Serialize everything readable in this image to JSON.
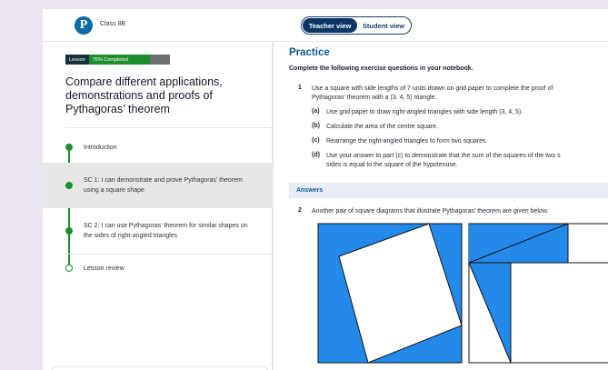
{
  "header": {
    "logo_letter": "P",
    "class_label": "Class 8B",
    "teacher_view": "Teacher view",
    "student_view": "Student view"
  },
  "sidebar": {
    "badge_lesson": "Lesson",
    "badge_progress": "75% Completed",
    "progress_fraction": 0.75,
    "title": "Compare different applications, demonstrations and proofs of Pythagoras’ theorem",
    "steps": [
      {
        "label": "Introduction"
      },
      {
        "label": "SC 1: I can demonstrate and prove Pythagoras’ theorem using a square shape"
      },
      {
        "label": "SC 2: I can use Pythagoras’ theorem for similar shapes on the sides of right-angled triangles"
      },
      {
        "label": "Lesson review"
      }
    ]
  },
  "main": {
    "heading": "Practice",
    "intro": "Complete the following exercise questions in your notebook.",
    "q1": {
      "number": "1",
      "line1": "Use a square with side lengths of 7 units drawn on grid paper to complete the proof of",
      "line2": "Pythagoras’ theorem with a (3, 4, 5) triangle.",
      "parts": [
        {
          "letter": "(a)",
          "text": "Use grid paper to draw right-angled triangles with side length (3, 4, 5)."
        },
        {
          "letter": "(b)",
          "text": "Calculate the area of the centre square."
        },
        {
          "letter": "(c)",
          "text": "Rearrange the right-angled triangles to form two squares."
        },
        {
          "letter": "(d)",
          "text": "Use your answer to part (c) to demonstrate that the sum of the squares of the two s",
          "text2": "sides is equal to the square of the hypotenuse."
        }
      ]
    },
    "answers_label": "Answers",
    "q2": {
      "number": "2",
      "text": "Another pair of square diagrams that illustrate Pythagoras’ theorem are given below."
    }
  },
  "colors": {
    "brand_blue": "#0a5a95",
    "toggle_active": "#0a3764",
    "progress_green": "#1e8f2e",
    "diagram_blue": "#2389ea"
  }
}
